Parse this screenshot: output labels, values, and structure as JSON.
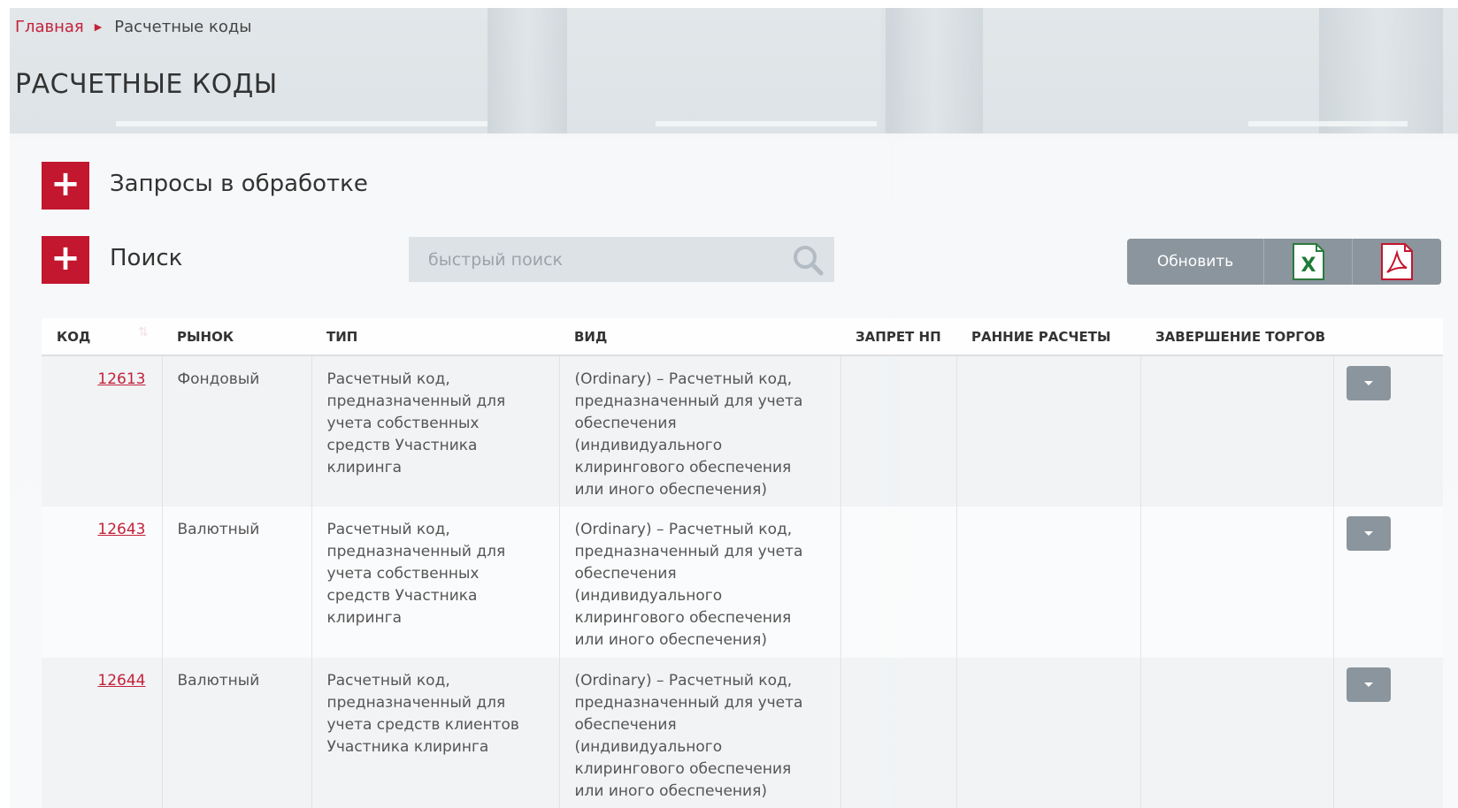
{
  "breadcrumb": {
    "home": "Главная",
    "separator_icon": "triangle-right-icon",
    "current": "Расчетные коды"
  },
  "page_title": "РАСЧЕТНЫЕ КОДЫ",
  "sections": {
    "requests": {
      "label": "Запросы в обработке",
      "icon": "plus-icon"
    },
    "search": {
      "label": "Поиск",
      "icon": "plus-icon"
    }
  },
  "quick_search": {
    "placeholder": "быстрый поиск",
    "value": "",
    "icon": "magnifier-icon"
  },
  "toolbar": {
    "refresh_label": "Обновить",
    "excel_icon": "excel-file-icon",
    "pdf_icon": "pdf-file-icon"
  },
  "colors": {
    "accent": "#c3162f",
    "button_gray": "#8b959d",
    "link": "#c3223a"
  },
  "table": {
    "columns": [
      "КОД",
      "РЫНОК",
      "ТИП",
      "ВИД",
      "ЗАПРЕТ НП",
      "РАННИЕ РАСЧЕТЫ",
      "ЗАВЕРШЕНИЕ ТОРГОВ"
    ],
    "sort_icon": "sort-descending-icon",
    "rows": [
      {
        "code": "12613",
        "market": "Фондовый",
        "type": "Расчетный код, предназначенный для учета собственных средств Участника клиринга",
        "kind": "(Ordinary) – Расчетный код, предназначенный для учета обеспечения (индивидуального клирингового обеспечения или иного обеспечения)",
        "np_ban": "",
        "early_settlement": "",
        "trading_end": ""
      },
      {
        "code": "12643",
        "market": "Валютный",
        "type": "Расчетный код, предназначенный для учета собственных средств Участника клиринга",
        "kind": "(Ordinary) – Расчетный код, предназначенный для учета обеспечения (индивидуального клирингового обеспечения или иного обеспечения)",
        "np_ban": "",
        "early_settlement": "",
        "trading_end": ""
      },
      {
        "code": "12644",
        "market": "Валютный",
        "type": "Расчетный код, предназначенный для учета средств клиентов Участника клиринга",
        "kind": "(Ordinary) – Расчетный код, предназначенный для учета обеспечения (индивидуального клирингового обеспечения или иного обеспечения)",
        "np_ban": "",
        "early_settlement": "",
        "trading_end": ""
      }
    ]
  }
}
